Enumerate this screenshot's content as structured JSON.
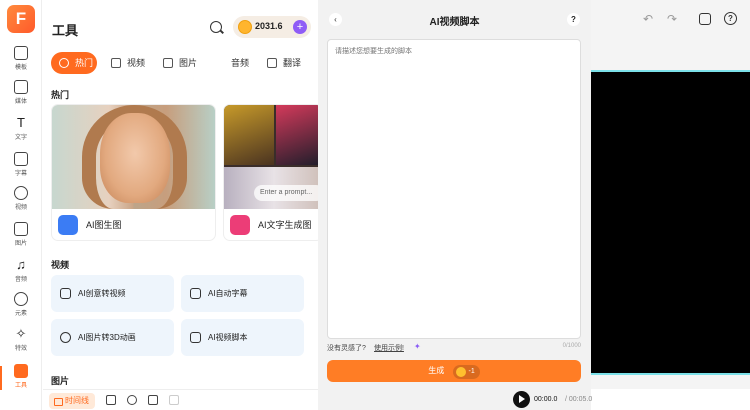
{
  "rail": {
    "logo": "F",
    "items": [
      {
        "label": "模板",
        "icon": "template-icon"
      },
      {
        "label": "媒体",
        "icon": "media-icon"
      },
      {
        "label": "文字",
        "icon": "text-icon"
      },
      {
        "label": "字幕",
        "icon": "subtitle-icon"
      },
      {
        "label": "视频",
        "icon": "video-icon"
      },
      {
        "label": "图片",
        "icon": "image-icon"
      },
      {
        "label": "音频",
        "icon": "music-icon"
      },
      {
        "label": "元素",
        "icon": "element-icon"
      },
      {
        "label": "特效",
        "icon": "effects-icon"
      },
      {
        "label": "工具",
        "icon": "toolbox-icon"
      }
    ]
  },
  "tools": {
    "title": "工具",
    "credits": "2031.6",
    "tabs": [
      {
        "label": "热门",
        "icon": "fire-icon"
      },
      {
        "label": "视频",
        "icon": "video-icon"
      },
      {
        "label": "图片",
        "icon": "image-icon"
      },
      {
        "label": "音频",
        "icon": "music-icon"
      },
      {
        "label": "翻译",
        "icon": "translate-icon"
      }
    ],
    "sections": {
      "hot": "热门",
      "video": "视频",
      "image": "图片"
    },
    "hot_cards": [
      {
        "label": "AI图生图",
        "icon": "ai-image-icon"
      },
      {
        "label": "AI文字生成图",
        "icon": "ai-text-image-icon"
      }
    ],
    "prompt_placeholder": "Enter a prompt...",
    "video_cards": [
      {
        "label": "AI创意转视频",
        "icon": "creative-video-icon"
      },
      {
        "label": "AI自动字幕",
        "icon": "auto-subtitle-icon"
      },
      {
        "label": "AI图片转3D动画",
        "icon": "3d-animation-icon"
      },
      {
        "label": "AI视频脚本",
        "icon": "video-script-icon"
      }
    ]
  },
  "dialog": {
    "title": "AI视频脚本",
    "back": "‹",
    "help": "?",
    "placeholder": "请描述您想要生成的脚本",
    "hint": "没有灵感了?",
    "example_link": "使用示例!",
    "count": "0/1000",
    "generate_label": "生成",
    "generate_cost": "-1"
  },
  "bottom": {
    "timeline": "时间线"
  },
  "player": {
    "current": "00:00.0",
    "total": "/ 00:05.0"
  },
  "colors": {
    "accent": "#ff6a1f",
    "purple": "#8f5cf6",
    "preview_border": "#7be0e8"
  }
}
